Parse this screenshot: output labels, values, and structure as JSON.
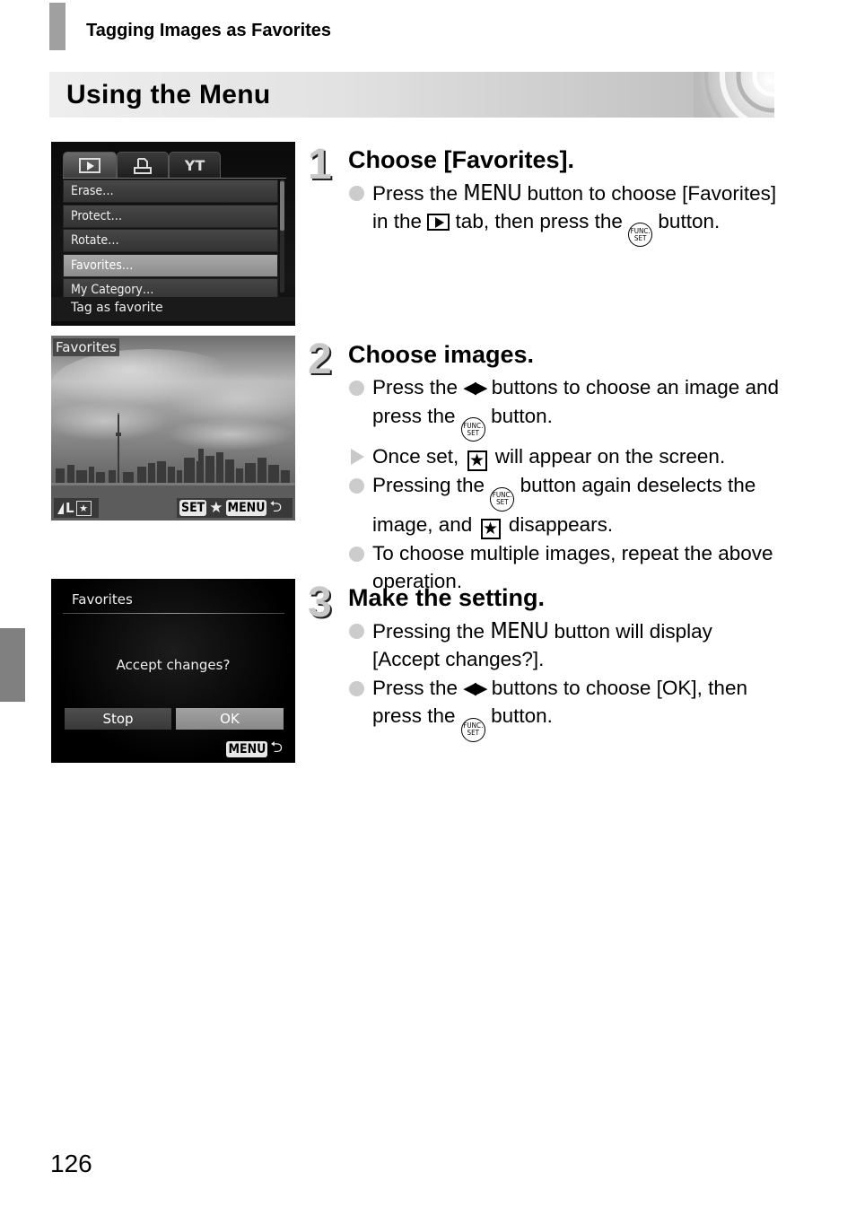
{
  "page": {
    "header_title": "Tagging Images as Favorites",
    "section_title": "Using the Menu",
    "page_number": "126"
  },
  "screen1": {
    "tabs": [
      {
        "icon": "play-icon",
        "glyph": "▶",
        "active": true
      },
      {
        "icon": "print-icon",
        "glyph": "⎙",
        "active": false
      },
      {
        "icon": "tools-icon",
        "glyph": "YT",
        "active": false
      }
    ],
    "menu_items": [
      {
        "label": "Erase…",
        "selected": false
      },
      {
        "label": "Protect…",
        "selected": false
      },
      {
        "label": "Rotate…",
        "selected": false
      },
      {
        "label": "Favorites…",
        "selected": true
      },
      {
        "label": "My Category…",
        "selected": false
      }
    ],
    "hint": "Tag as favorite"
  },
  "screen2": {
    "label": "Favorites",
    "left_indicator": "L",
    "set_key": "SET",
    "star": "★",
    "menu_key": "MENU",
    "return": "⮌"
  },
  "screen3": {
    "title": "Favorites",
    "message": "Accept changes?",
    "stop_label": "Stop",
    "ok_label": "OK",
    "menu_key": "MENU",
    "return": "⮌"
  },
  "steps": [
    {
      "number": "1",
      "title": "Choose [Favorites].",
      "bullets": [
        {
          "type": "dot",
          "parts": [
            "Press the ",
            "MENU",
            " button to choose [Favorites] in the ",
            "▶",
            " tab, then press the ",
            "FUNC SET",
            " button."
          ]
        }
      ]
    },
    {
      "number": "2",
      "title": "Choose images.",
      "bullets": [
        {
          "type": "dot",
          "parts": [
            "Press the ",
            "◀▶",
            " buttons to choose an image and press the ",
            "FUNC SET",
            " button."
          ]
        },
        {
          "type": "arrow",
          "parts": [
            "Once set, ",
            "★",
            " will appear on the screen."
          ]
        },
        {
          "type": "dot",
          "parts": [
            "Pressing the ",
            "FUNC SET",
            " button again deselects the image, and ",
            "★",
            " disappears."
          ]
        },
        {
          "type": "dot",
          "parts": [
            "To choose multiple images, repeat the above operation."
          ]
        }
      ]
    },
    {
      "number": "3",
      "title": "Make the setting.",
      "bullets": [
        {
          "type": "dot",
          "parts": [
            "Pressing the ",
            "MENU",
            " button will display [Accept changes?]."
          ]
        },
        {
          "type": "dot",
          "parts": [
            "Press the ",
            "◀▶",
            " buttons to choose [OK], then press the ",
            "FUNC SET",
            " button."
          ]
        }
      ]
    }
  ],
  "icons": {
    "func_top": "FUNC.",
    "func_bottom": "SET",
    "lr_arrows": "◀▶",
    "star": "★"
  }
}
